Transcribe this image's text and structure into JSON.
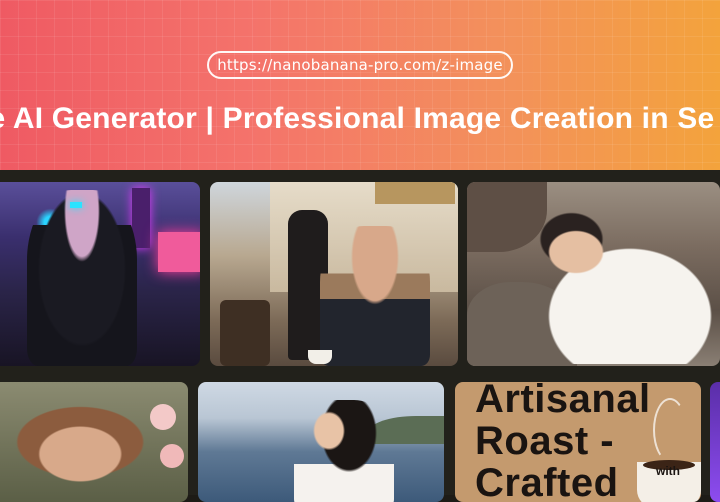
{
  "header": {
    "url": "https://nanobanana-pro.com/z-image",
    "title": "ge AI Generator | Professional Image Creation in Se"
  },
  "gallery": {
    "cards": [
      {
        "name": "cyberpunk-robot-image"
      },
      {
        "name": "street-cafe-image"
      },
      {
        "name": "woman-on-rocks-image"
      },
      {
        "name": "portrait-woman-image"
      },
      {
        "name": "seaside-woman-image"
      },
      {
        "name": "coffee-poster-image",
        "text": "Artisanal Roast - Crafted",
        "cup_text": "with"
      },
      {
        "name": "purple-card-image"
      }
    ]
  },
  "colors": {
    "header_gradient_start": "#ef5a63",
    "header_gradient_end": "#f3a33c",
    "gallery_bg": "#22211b"
  }
}
